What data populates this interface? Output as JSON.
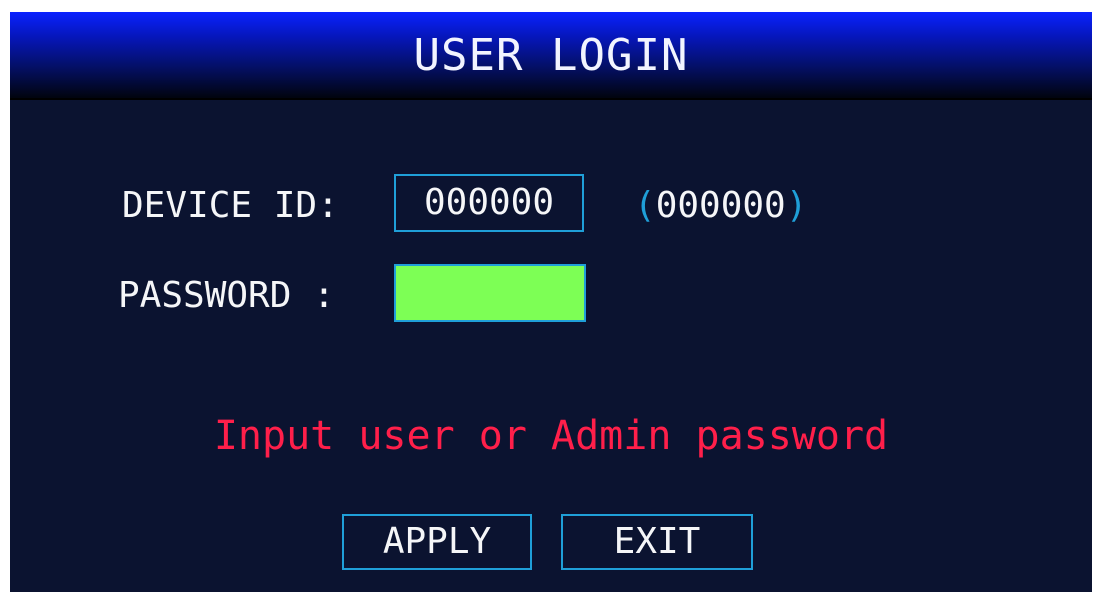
{
  "header": {
    "title": "USER LOGIN"
  },
  "form": {
    "device_id_label": "DEVICE ID:",
    "device_id_value": "000000",
    "device_id_hint_open": "(",
    "device_id_hint_value": "000000",
    "device_id_hint_close": ")",
    "password_label": "PASSWORD :",
    "password_value": ""
  },
  "message": {
    "text": "Input user or Admin password"
  },
  "buttons": {
    "apply_label": "APPLY",
    "exit_label": "EXIT"
  },
  "colors": {
    "background": "#0b1330",
    "accent_border": "#1f9fd8",
    "password_field_active": "#7dff55",
    "warning_text": "#ff1f4a",
    "title_bar_blue": "#0a22ff"
  }
}
